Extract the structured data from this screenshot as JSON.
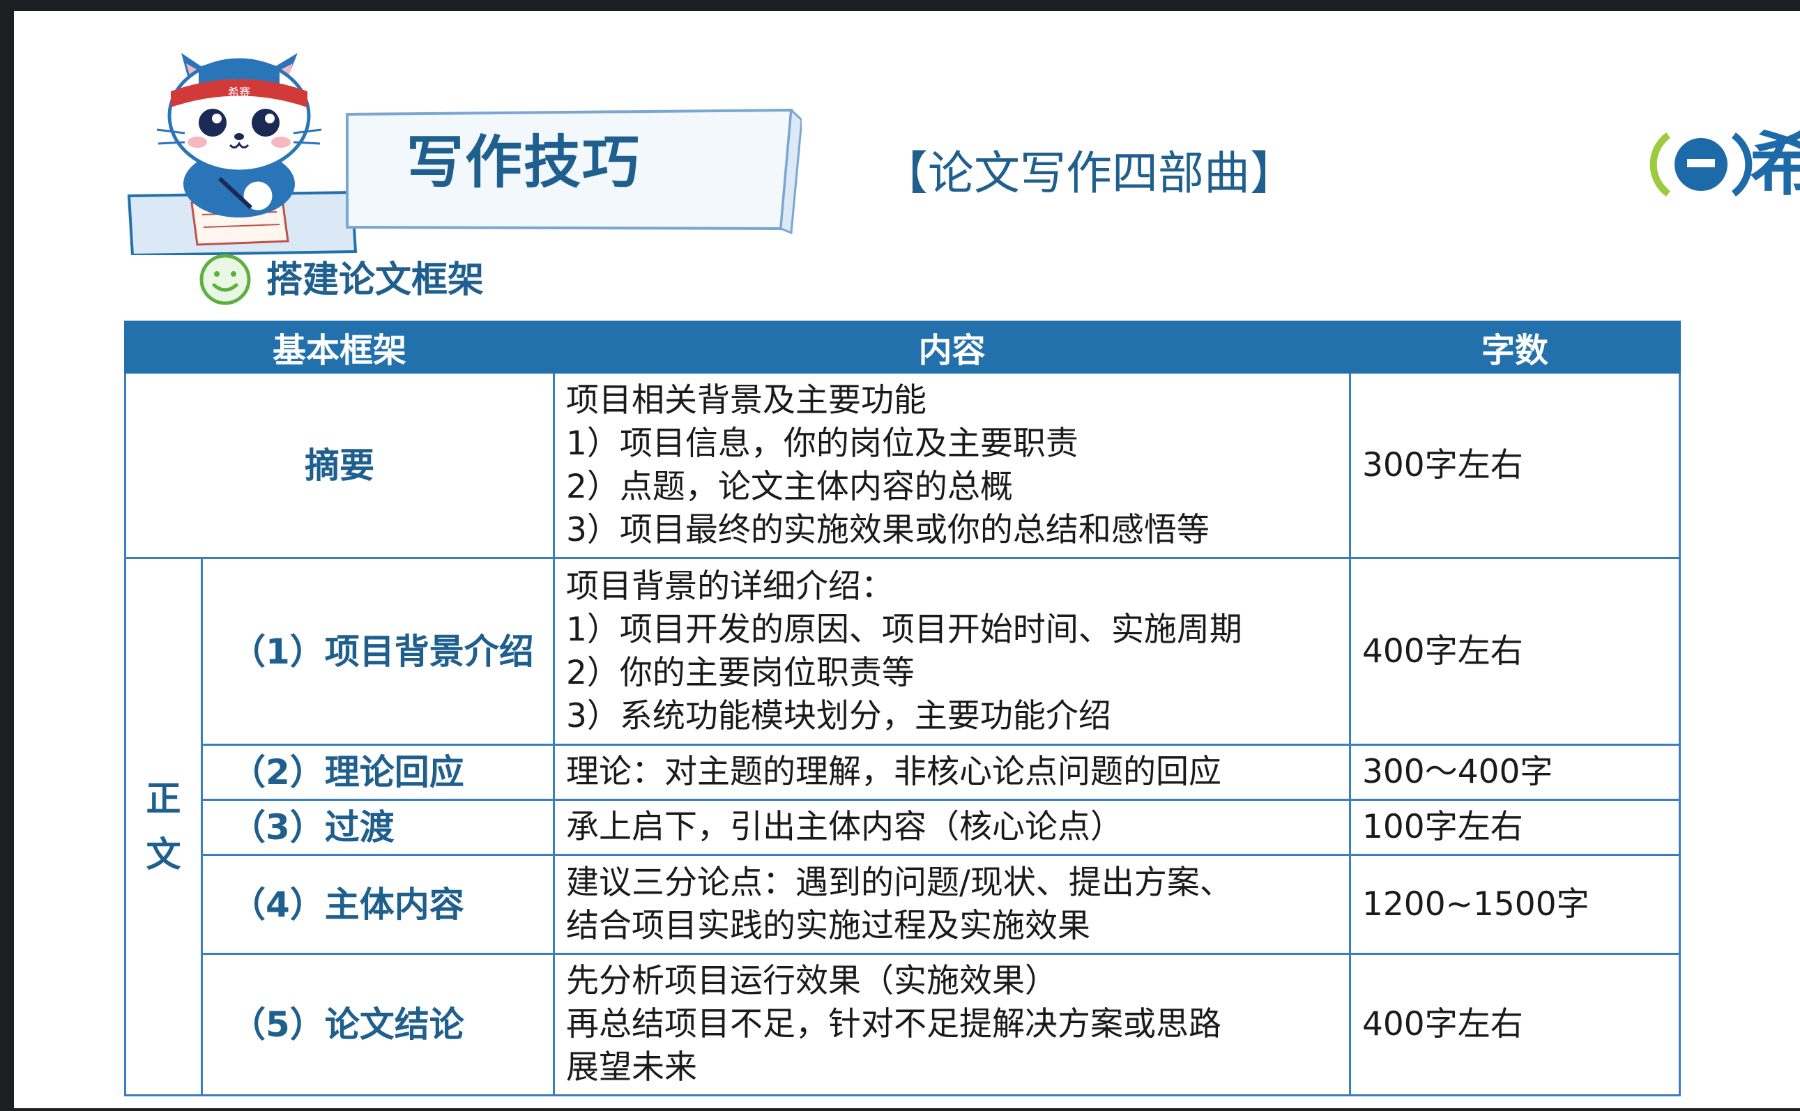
{
  "header": {
    "title": "写作技巧",
    "subtitle": "【论文写作四部曲】",
    "mascot_headband_text": "希赛",
    "logo_text": "希"
  },
  "section": {
    "icon": "smile-icon",
    "title": "搭建论文框架"
  },
  "table": {
    "headers": [
      "基本框架",
      "内容",
      "字数"
    ],
    "zhengwen_label": "正\n文",
    "zhengwen_char1": "正",
    "zhengwen_char2": "文",
    "rows": [
      {
        "label": "摘要",
        "content": [
          "项目相关背景及主要功能",
          "1）项目信息，你的岗位及主要职责",
          "2）点题，论文主体内容的总概",
          "3）项目最终的实施效果或你的总结和感悟等"
        ],
        "words": "300字左右"
      },
      {
        "label": "（1）项目背景介绍",
        "content": [
          "项目背景的详细介绍：",
          "1）项目开发的原因、项目开始时间、实施周期",
          "2）你的主要岗位职责等",
          "3）系统功能模块划分，主要功能介绍"
        ],
        "words": "400字左右"
      },
      {
        "label": "（2）理论回应",
        "content": [
          "理论：对主题的理解，非核心论点问题的回应"
        ],
        "words": "300～400字"
      },
      {
        "label": "（3）过渡",
        "content": [
          "承上启下，引出主体内容（核心论点）"
        ],
        "words": "100字左右"
      },
      {
        "label": "（4）主体内容",
        "content": [
          "建议三分论点：遇到的问题/现状、提出方案、",
          "结合项目实践的实施过程及实施效果"
        ],
        "words": "1200~1500字"
      },
      {
        "label": "（5）论文结论",
        "content": [
          "先分析项目运行效果（实施效果）",
          "再总结项目不足，针对不足提解决方案或思路",
          "展望未来"
        ],
        "words": "400字左右"
      }
    ]
  },
  "colors": {
    "accent": "#2271ad",
    "title_blue": "#1f5f8e",
    "border": "#3a7ec0",
    "frame": "#1e1f22"
  }
}
